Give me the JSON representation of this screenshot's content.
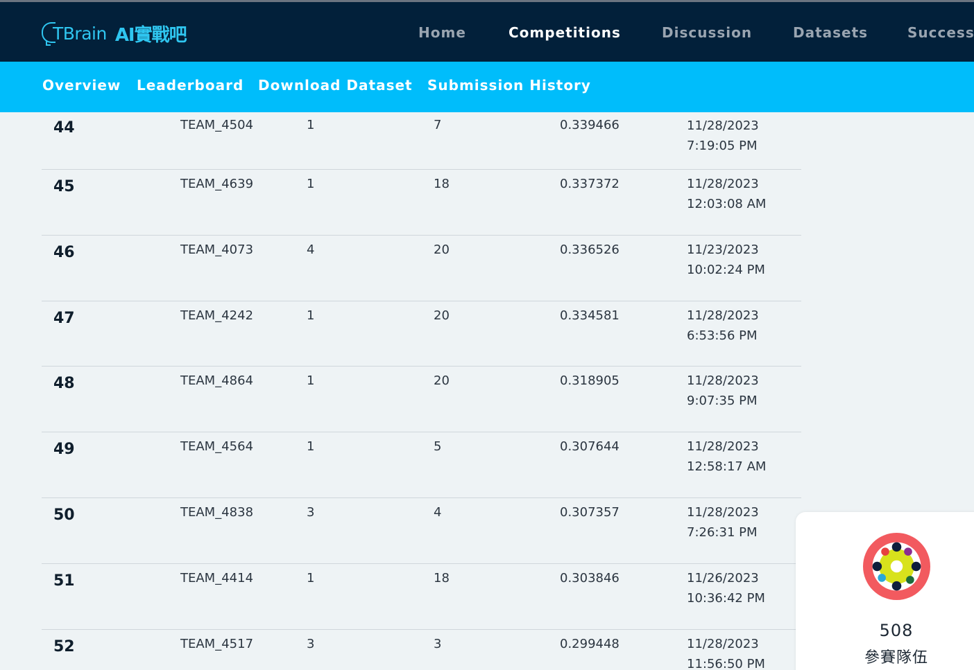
{
  "header": {
    "logo_text": "TBrain",
    "logo_ai": "AI實戰吧",
    "nav": [
      {
        "label": "Home"
      },
      {
        "label": "Competitions"
      },
      {
        "label": "Discussion"
      },
      {
        "label": "Datasets"
      },
      {
        "label": "Success"
      }
    ],
    "active_nav": "Competitions"
  },
  "subnav": [
    {
      "label": "Overview"
    },
    {
      "label": "Leaderboard"
    },
    {
      "label": "Download Dataset"
    },
    {
      "label": "Submission History"
    }
  ],
  "leaderboard": {
    "rows": [
      {
        "rank": "44",
        "team": "TEAM_4504",
        "entries": "1",
        "count": "7",
        "score": "0.339466",
        "date": "11/28/2023",
        "time": "7:19:05 PM"
      },
      {
        "rank": "45",
        "team": "TEAM_4639",
        "entries": "1",
        "count": "18",
        "score": "0.337372",
        "date": "11/28/2023",
        "time": "12:03:08 AM"
      },
      {
        "rank": "46",
        "team": "TEAM_4073",
        "entries": "4",
        "count": "20",
        "score": "0.336526",
        "date": "11/23/2023",
        "time": "10:02:24 PM"
      },
      {
        "rank": "47",
        "team": "TEAM_4242",
        "entries": "1",
        "count": "20",
        "score": "0.334581",
        "date": "11/28/2023",
        "time": "6:53:56 PM"
      },
      {
        "rank": "48",
        "team": "TEAM_4864",
        "entries": "1",
        "count": "20",
        "score": "0.318905",
        "date": "11/28/2023",
        "time": "9:07:35 PM"
      },
      {
        "rank": "49",
        "team": "TEAM_4564",
        "entries": "1",
        "count": "5",
        "score": "0.307644",
        "date": "11/28/2023",
        "time": "12:58:17 AM"
      },
      {
        "rank": "50",
        "team": "TEAM_4838",
        "entries": "3",
        "count": "4",
        "score": "0.307357",
        "date": "11/28/2023",
        "time": "7:26:31 PM"
      },
      {
        "rank": "51",
        "team": "TEAM_4414",
        "entries": "1",
        "count": "18",
        "score": "0.303846",
        "date": "11/26/2023",
        "time": "10:36:42 PM"
      },
      {
        "rank": "52",
        "team": "TEAM_4517",
        "entries": "3",
        "count": "3",
        "score": "0.299448",
        "date": "11/28/2023",
        "time": "11:56:50 PM"
      }
    ]
  },
  "teams_card": {
    "icon": "teams-icon",
    "count": "508",
    "label": "參賽隊伍"
  },
  "colors": {
    "topbar": "#02203a",
    "subbar": "#00bdfb",
    "page_bg": "#eef3f5",
    "logo": "#2fc6f0"
  }
}
